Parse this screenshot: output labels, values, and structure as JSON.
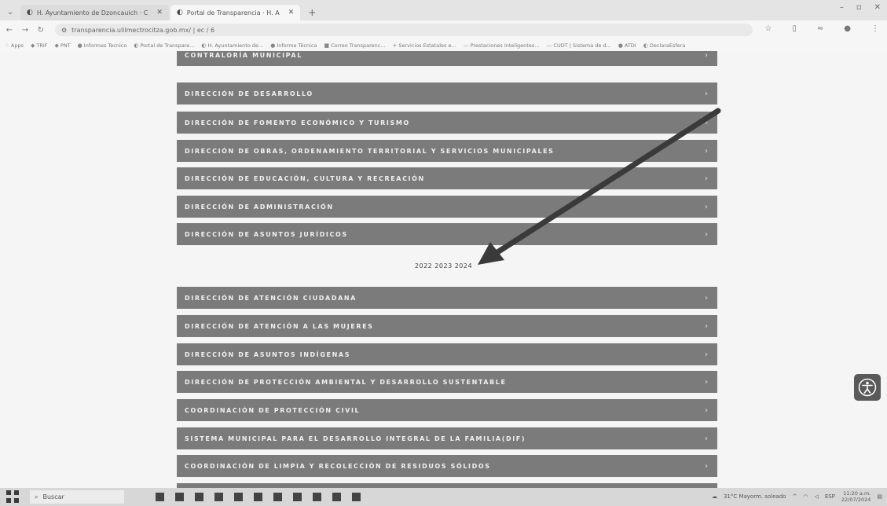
{
  "browser": {
    "tabs": [
      {
        "title": "H. Ayuntamiento de Dzoncauich · C",
        "active": false
      },
      {
        "title": "Portal de Transparencia · H. A",
        "active": true
      }
    ],
    "new_tab": "+",
    "url": "transparencia.ulilmectrocitza.gob.mx/ | ec / 6",
    "bookmarks": [
      "Apps",
      "TRIF",
      "PNT",
      "Informes Tecnico",
      "Portal de Transpare...",
      "H. Ayuntamiento de...",
      "Informe Técnica",
      "Correo Transparenc...",
      "Servicios Estatales e...",
      "Prestaciones Inteligentes...",
      "CUDT | Sistema de d...",
      "ATDI",
      "DeclaraEsfera"
    ]
  },
  "directorate_sections": {
    "group_one": [
      "CONTRALORÍA MUNICIPAL",
      "DIRECCIÓN DE DESARROLLO",
      "DIRECCIÓN DE FOMENTO ECONÓMICO Y TURISMO",
      "DIRECCIÓN DE OBRAS, ORDENAMIENTO TERRITORIAL Y SERVICIOS MUNICIPALES",
      "DIRECCIÓN DE EDUCACIÓN, CULTURA Y RECREACIÓN",
      "DIRECCIÓN DE ADMINISTRACIÓN",
      "DIRECCIÓN DE ASUNTOS JURÍDICOS"
    ],
    "years_label": "2022 2023 2024",
    "group_two": [
      "DIRECCIÓN DE ATENCIÓN CIUDADANA",
      "DIRECCIÓN DE ATENCIÓN A LAS MUJERES",
      "DIRECCIÓN DE ASUNTOS INDÍGENAS",
      "DIRECCIÓN DE PROTECCIÓN AMBIENTAL Y DESARROLLO SUSTENTABLE",
      "COORDINACIÓN DE PROTECCIÓN CIVIL",
      "SISTEMA MUNICIPAL PARA EL DESARROLLO INTEGRAL DE LA FAMILIA(DIF)",
      "COORDINACIÓN DE LIMPIA Y RECOLECCIÓN DE RESIDUOS SÓLIDOS"
    ],
    "chevron": "›"
  },
  "taskbar": {
    "search_placeholder": "Buscar",
    "weather": "31°C Mayorm. soleado",
    "language": "ESP",
    "time": "11:20 a.m.",
    "date": "22/07/2024"
  },
  "colors": {
    "item_bg": "#7b7b7b",
    "arrow": "#3a3a3a",
    "accessibility_bg": "#5a5a5a"
  }
}
